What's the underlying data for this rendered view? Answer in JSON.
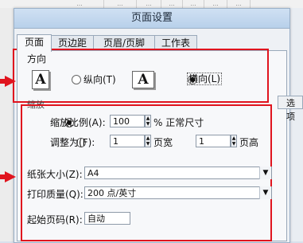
{
  "sheet": {
    "top_cells": [
      "…",
      "…",
      "…",
      "…",
      "…",
      "…",
      "…"
    ]
  },
  "dialog": {
    "title": "页面设置",
    "tabs": [
      {
        "label": "页面"
      },
      {
        "label": "页边距"
      },
      {
        "label": "页眉/页脚"
      },
      {
        "label": "工作表"
      }
    ],
    "orientation": {
      "group_label": "方向",
      "portrait_label": "纵向(T)",
      "landscape_label": "横向(L)",
      "icon_letter": "A",
      "selected": "landscape"
    },
    "scaling": {
      "group_label": "缩放",
      "adjust_label": "缩放比例(A):",
      "adjust_value": "100",
      "adjust_suffix": "% 正常尺寸",
      "fit_label": "调整为(F):",
      "fit_wide_value": "1",
      "fit_wide_label": "页宽",
      "fit_tall_value": "1",
      "fit_tall_label": "页高",
      "selected": "adjust"
    },
    "paper_size": {
      "label": "纸张大小(Z):",
      "value": "A4"
    },
    "print_quality": {
      "label": "打印质量(Q):",
      "value": "200 点/英寸"
    },
    "first_page": {
      "label": "起始页码(R):",
      "value": "自动"
    }
  },
  "side_button": {
    "label": "选项"
  },
  "colors": {
    "highlight": "#e0141e",
    "title_bg": "#cfe0f3"
  }
}
